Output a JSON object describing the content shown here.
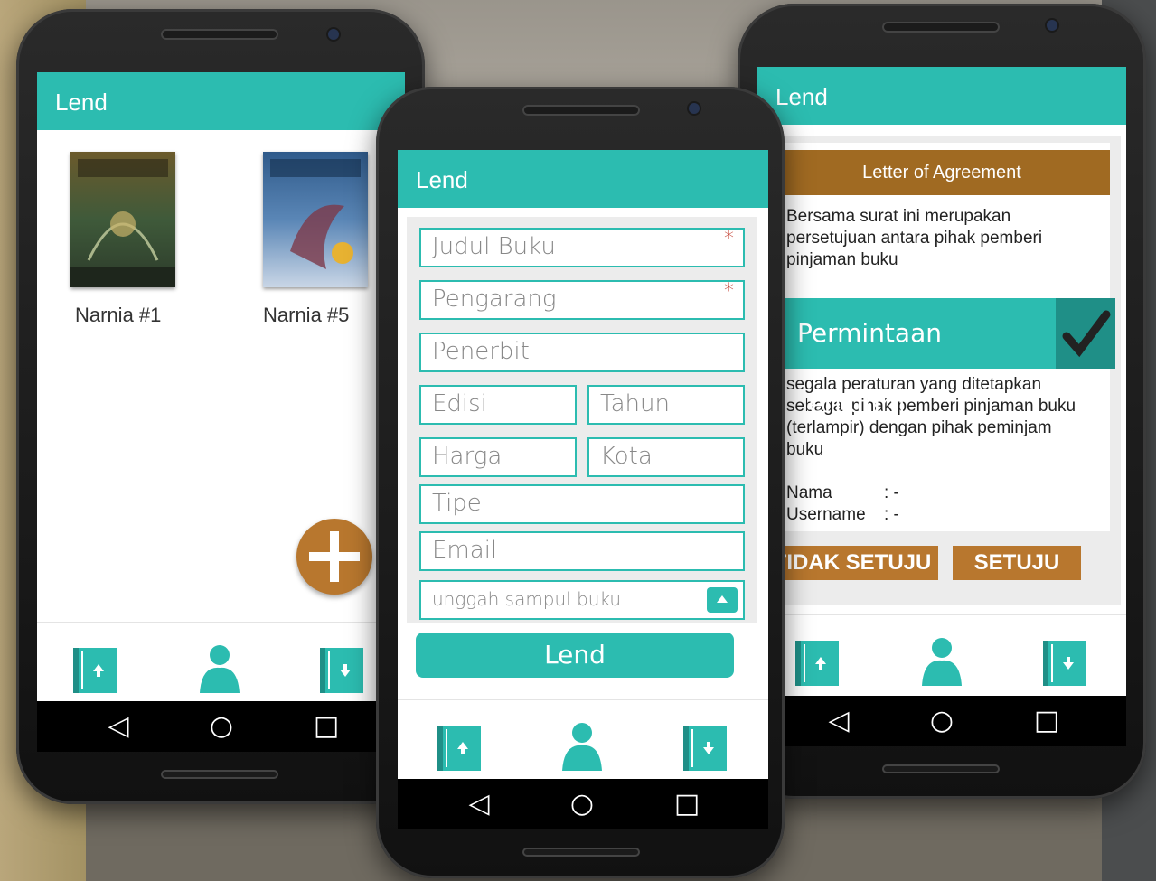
{
  "colors": {
    "accent": "#2cbcb0",
    "brown": "#b8772e",
    "brown_dark": "#a06a22"
  },
  "app": {
    "title": "Lend"
  },
  "phone1": {
    "books": [
      {
        "title": "Narnia #1"
      },
      {
        "title": "Narnia #5"
      }
    ],
    "fab_icon": "plus-icon"
  },
  "phone2": {
    "fields": {
      "judul": "Judul Buku",
      "pengarang": "Pengarang",
      "penerbit": "Penerbit",
      "edisi": "Edisi",
      "tahun": "Tahun",
      "harga": "Harga",
      "kota": "Kota",
      "tipe": "Tipe",
      "email": "Email",
      "upload": "unggah sampul buku"
    },
    "required_mark": "*",
    "submit_label": "Lend"
  },
  "phone3": {
    "header": "Letter of Agreement",
    "paragraph1": "Bersama surat ini merupakan persetujuan antara pihak pemberi pinjaman buku",
    "paragraph2": "segala peraturan yang ditetapkan sebagai pihak pemberi pinjaman buku (terlampir) dengan pihak peminjam buku",
    "nama_label": "Nama",
    "nama_value": ": -",
    "username_label": "Username",
    "username_value": ": -",
    "toast": "Permintaan Terikirim",
    "reject_label": "TIDAK SETUJU",
    "accept_label": "SETUJU"
  },
  "nav": {
    "icons": [
      "book-upload-icon",
      "person-icon",
      "book-download-icon"
    ]
  },
  "system_nav": {
    "back": "◁",
    "home": "○",
    "recents": "□"
  }
}
